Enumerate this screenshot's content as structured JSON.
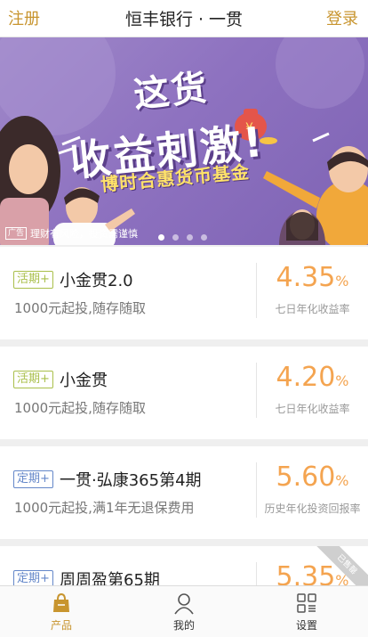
{
  "header": {
    "register_label": "注册",
    "title": "恒丰银行 · 一贯",
    "login_label": "登录"
  },
  "banner": {
    "headline_line1": "这货",
    "headline_line2": "收益刺激!",
    "subline": "博时合惠货币基金",
    "ad_tag": "广告",
    "ad_text": "理财有风险，投资需谨慎",
    "dots_count": 4,
    "active_dot": 1
  },
  "products": [
    {
      "tag": "活期+",
      "tag_type": "huo",
      "name": "小金贯2.0",
      "desc": "1000元起投,随存随取",
      "rate": "4.35",
      "rate_unit": "%",
      "rate_label": "七日年化收益率"
    },
    {
      "tag": "活期+",
      "tag_type": "huo",
      "name": "小金贯",
      "desc": "1000元起投,随存随取",
      "rate": "4.20",
      "rate_unit": "%",
      "rate_label": "七日年化收益率"
    },
    {
      "tag": "定期+",
      "tag_type": "ding",
      "name": "一贯·弘康365第4期",
      "desc": "1000元起投,满1年无退保费用",
      "rate": "5.60",
      "rate_unit": "%",
      "rate_label": "历史年化投资回报率"
    },
    {
      "tag": "定期+",
      "tag_type": "ding",
      "name": "周周盈第65期",
      "desc": "",
      "rate": "5.35",
      "rate_unit": "%",
      "rate_label": "",
      "ribbon": "已售罄"
    }
  ],
  "tabs": [
    {
      "label": "产品",
      "icon": "bag-icon",
      "active": true
    },
    {
      "label": "我的",
      "icon": "person-icon",
      "active": false
    },
    {
      "label": "设置",
      "icon": "grid-icon",
      "active": false
    }
  ],
  "colors": {
    "accent": "#c8952f",
    "rate": "#f4a450",
    "tag_current": "#a9bf4a",
    "tag_fixed": "#6487c9",
    "banner_bg": "#8e72c0"
  }
}
